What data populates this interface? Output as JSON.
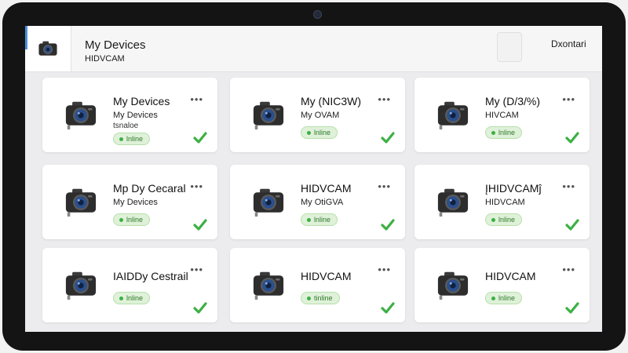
{
  "header": {
    "title": "My Devices",
    "subtitle": "HIDVCAM",
    "action_label": "Dxontari"
  },
  "colors": {
    "online_green": "#3cb043",
    "accent_blue": "#4a90d9",
    "bezel": "#141414"
  },
  "icons": {
    "device": "camera-icon",
    "menu": "more-icon",
    "status": "check-icon"
  },
  "devices": [
    {
      "title": "My Devices",
      "subtitle": "My Devices",
      "extra": "tsnaloe",
      "status": "lnline"
    },
    {
      "title": "My (NIC3W)",
      "subtitle": "My OVAM",
      "extra": "",
      "status": "lnline"
    },
    {
      "title": "My (D/3/%)",
      "subtitle": "HIVCAM",
      "extra": "",
      "status": "lnline"
    },
    {
      "title": "Mp Dy Cecaral",
      "subtitle": "My Devices",
      "extra": "",
      "status": "lnline"
    },
    {
      "title": "HIDVCAM",
      "subtitle": "My OtiGVA",
      "extra": "",
      "status": "lnline"
    },
    {
      "title": "ĮHIDVCAMĵ",
      "subtitle": "HIDVCAM",
      "extra": "",
      "status": "lnline"
    },
    {
      "title": "IAIDDy Cestrail",
      "subtitle": "",
      "extra": "",
      "status": "lnline"
    },
    {
      "title": "HIDVCAM",
      "subtitle": "",
      "extra": "",
      "status": "tinline"
    },
    {
      "title": "HIDVCAM",
      "subtitle": "",
      "extra": "",
      "status": "lnline"
    }
  ]
}
